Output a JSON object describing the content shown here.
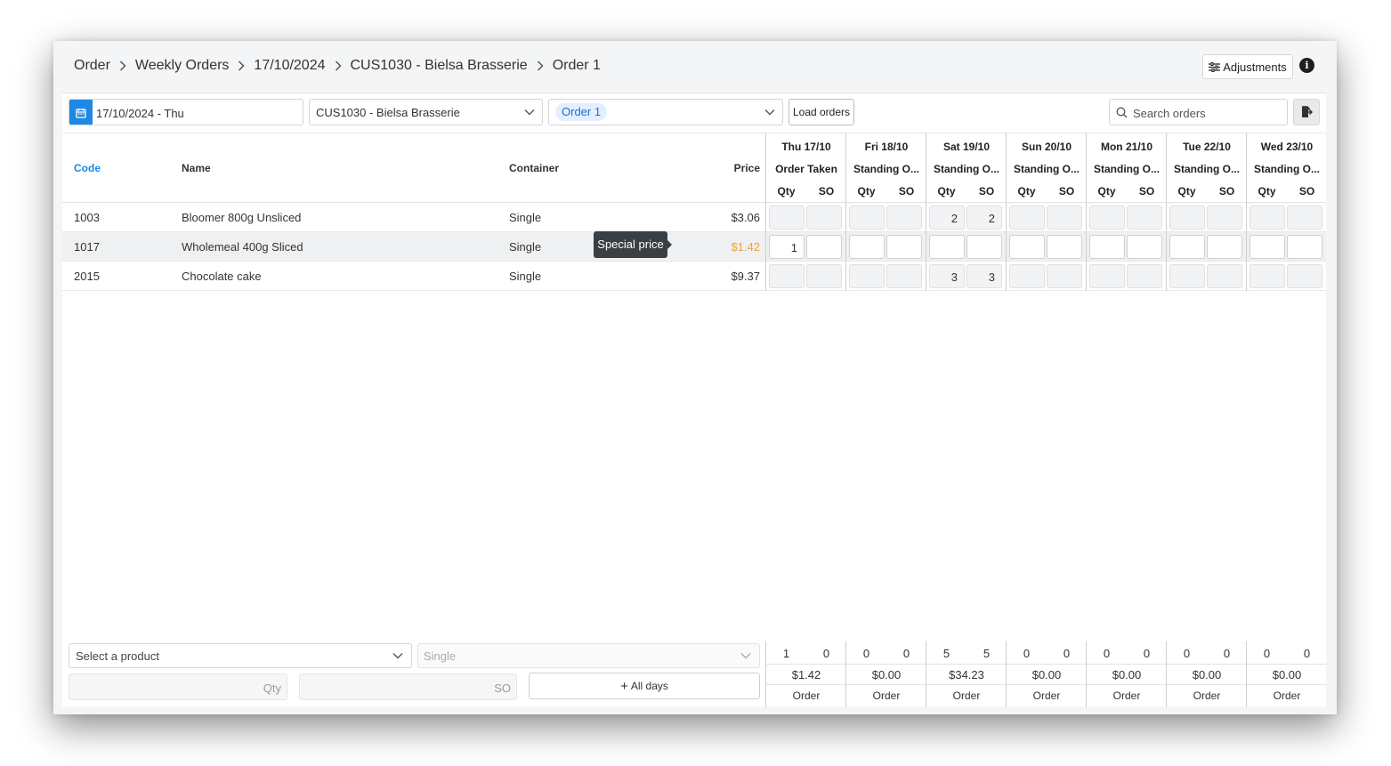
{
  "breadcrumb": [
    "Order",
    "Weekly Orders",
    "17/10/2024",
    "CUS1030 - Bielsa Brasserie",
    "Order 1"
  ],
  "header": {
    "adjustments_label": "Adjustments",
    "info_glyph": "i"
  },
  "toolbar": {
    "date": "17/10/2024 - Thu",
    "customer": "CUS1030 - Bielsa Brasserie",
    "order_chip": "Order 1",
    "load_label": "Load orders",
    "search_placeholder": "Search orders"
  },
  "columns": {
    "code": "Code",
    "name": "Name",
    "container": "Container",
    "price": "Price",
    "qty": "Qty",
    "so": "SO"
  },
  "days": [
    {
      "date": "Thu 17/10",
      "type": "Order Taken"
    },
    {
      "date": "Fri 18/10",
      "type": "Standing O..."
    },
    {
      "date": "Sat 19/10",
      "type": "Standing O..."
    },
    {
      "date": "Sun 20/10",
      "type": "Standing O..."
    },
    {
      "date": "Mon 21/10",
      "type": "Standing O..."
    },
    {
      "date": "Tue 22/10",
      "type": "Standing O..."
    },
    {
      "date": "Wed 23/10",
      "type": "Standing O..."
    }
  ],
  "rows": [
    {
      "code": "1003",
      "name": "Bloomer 800g Unsliced",
      "container": "Single",
      "price": "$3.06",
      "special": false,
      "qty": [
        "",
        "",
        "2",
        "",
        "",
        "",
        ""
      ],
      "so": [
        "",
        "",
        "2",
        "",
        "",
        "",
        ""
      ]
    },
    {
      "code": "1017",
      "name": "Wholemeal 400g Sliced",
      "container": "Single",
      "price": "$1.42",
      "special": true,
      "qty": [
        "1",
        "",
        "",
        "",
        "",
        "",
        ""
      ],
      "so": [
        "",
        "",
        "",
        "",
        "",
        "",
        ""
      ]
    },
    {
      "code": "2015",
      "name": "Chocolate cake",
      "container": "Single",
      "price": "$9.37",
      "special": false,
      "qty": [
        "",
        "",
        "3",
        "",
        "",
        "",
        ""
      ],
      "so": [
        "",
        "",
        "3",
        "",
        "",
        "",
        ""
      ]
    }
  ],
  "tooltip": "Special price",
  "footer": {
    "product_placeholder": "Select a product",
    "container_placeholder": "Single",
    "qty_placeholder": "Qty",
    "so_placeholder": "SO",
    "all_days_label": "All days",
    "totals": [
      {
        "qty": "1",
        "so": "0",
        "total": "$1.42",
        "action": "Order"
      },
      {
        "qty": "0",
        "so": "0",
        "total": "$0.00",
        "action": "Order"
      },
      {
        "qty": "5",
        "so": "5",
        "total": "$34.23",
        "action": "Order"
      },
      {
        "qty": "0",
        "so": "0",
        "total": "$0.00",
        "action": "Order"
      },
      {
        "qty": "0",
        "so": "0",
        "total": "$0.00",
        "action": "Order"
      },
      {
        "qty": "0",
        "so": "0",
        "total": "$0.00",
        "action": "Order"
      },
      {
        "qty": "0",
        "so": "0",
        "total": "$0.00",
        "action": "Order"
      }
    ]
  },
  "colors": {
    "accent": "#1e88e5",
    "special_price": "#f0a040",
    "tooltip_bg": "#3a3f44"
  }
}
